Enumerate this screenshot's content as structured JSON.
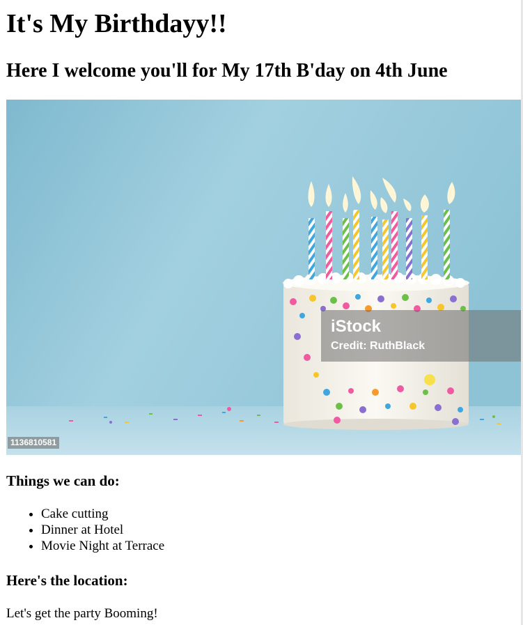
{
  "header": {
    "title": "It's My Birthdayy!!",
    "subtitle": "Here I welcome you'll for My 17th B'day on 4th June"
  },
  "photo": {
    "watermark_brand": "iStock",
    "watermark_credit": "Credit: RuthBlack",
    "image_id": "1136810581"
  },
  "activities": {
    "heading": "Things we can do:",
    "items": [
      "Cake cutting",
      "Dinner at Hotel",
      "Movie Night at Terrace"
    ]
  },
  "location": {
    "heading": "Here's the location:"
  },
  "closing": {
    "text": "Let's get the party Booming!"
  }
}
